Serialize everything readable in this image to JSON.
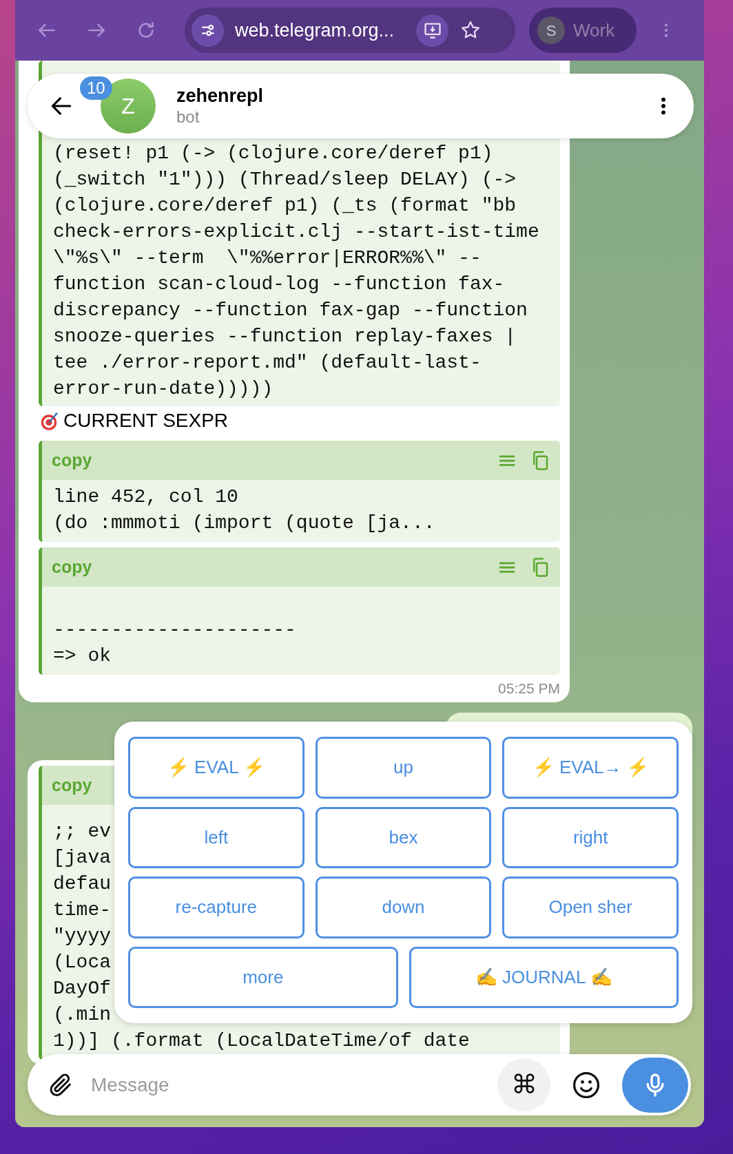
{
  "browser": {
    "address": "web.telegram.org...",
    "profile_initial": "S",
    "profile_name": "Work"
  },
  "chat": {
    "unread_count": "10",
    "avatar_initial": "Z",
    "title": "zehenrepl",
    "subtitle": "bot"
  },
  "messages": [
    {
      "kind": "incoming",
      "code": {
        "text": "(reset! p1 (-> (clojure.core/deref p1)\n(_switch \"1\"))) (Thread/sleep DELAY) (->\n(clojure.core/deref p1) (_ts (format \"bb\ncheck-errors-explicit.clj --start-ist-time\n\\\"%s\\\" --term  \\\"%%error|ERROR%%\\\" --\nfunction scan-cloud-log --function fax-\ndiscrepancy --function fax-gap --function\nsnooze-queries --function replay-faxes |\ntee ./error-report.md\" (default-last-\nerror-run-date)))))"
      },
      "heading": "CURRENT SEXPR",
      "code_blocks": [
        {
          "label": "copy",
          "text": "line 452, col 10\n(do :mmmoti (import (quote [ja..."
        },
        {
          "label": "copy",
          "text": "\n---------------------\n=> ok"
        }
      ],
      "time": "05:25 PM"
    },
    {
      "kind": "outgoing"
    },
    {
      "kind": "incoming",
      "code_blocks": [
        {
          "label": "copy",
          "text": ";; ev\n[java\ndefau\ntime-\n\"yyyy\n(Loca\nDayOf\n(.min\n1))] (.format (LocalDateTime/of date"
        }
      ]
    }
  ],
  "keyboard": {
    "rows": [
      [
        {
          "label": "⚡ EVAL ⚡"
        },
        {
          "label": "up"
        },
        {
          "label": "⚡ EVAL→ ⚡"
        }
      ],
      [
        {
          "label": "left"
        },
        {
          "label": "bex"
        },
        {
          "label": "right"
        }
      ],
      [
        {
          "label": "re-capture"
        },
        {
          "label": "down"
        },
        {
          "label": "Open sher"
        }
      ]
    ],
    "bottom_row": [
      {
        "label": "more"
      },
      {
        "label": "✍ JOURNAL ✍"
      }
    ]
  },
  "composer": {
    "placeholder": "Message",
    "command_key": "⌘"
  }
}
